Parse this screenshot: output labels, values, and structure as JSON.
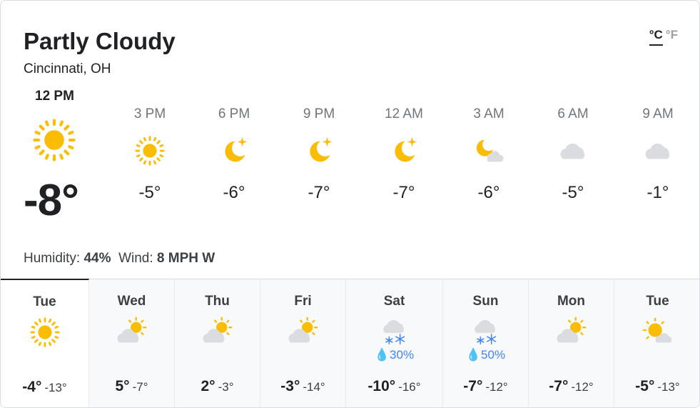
{
  "header": {
    "condition": "Partly Cloudy",
    "location": "Cincinnati, OH",
    "unit_c": "°C",
    "unit_f": "°F"
  },
  "now": {
    "time": "12 PM",
    "temp": "-8°",
    "icon": "sun-icon"
  },
  "hourly": [
    {
      "time": "3 PM",
      "temp": "-5°",
      "icon": "sun-icon"
    },
    {
      "time": "6 PM",
      "temp": "-6°",
      "icon": "moon-star-icon"
    },
    {
      "time": "9 PM",
      "temp": "-7°",
      "icon": "moon-star-icon"
    },
    {
      "time": "12 AM",
      "temp": "-7°",
      "icon": "moon-star-icon"
    },
    {
      "time": "3 AM",
      "temp": "-6°",
      "icon": "moon-cloud-icon"
    },
    {
      "time": "6 AM",
      "temp": "-5°",
      "icon": "cloud-icon"
    },
    {
      "time": "9 AM",
      "temp": "-1°",
      "icon": "cloud-icon"
    }
  ],
  "details": {
    "humidity_label": "Humidity:",
    "humidity_value": "44%",
    "wind_label": "Wind:",
    "wind_value": "8 MPH W"
  },
  "daily": [
    {
      "day": "Tue",
      "hi": "-4°",
      "lo": "-13°",
      "precip": "",
      "icon": "sun-icon"
    },
    {
      "day": "Wed",
      "hi": "5°",
      "lo": "-7°",
      "precip": "",
      "icon": "cloud-sun-icon"
    },
    {
      "day": "Thu",
      "hi": "2°",
      "lo": "-3°",
      "precip": "",
      "icon": "cloud-sun-icon"
    },
    {
      "day": "Fri",
      "hi": "-3°",
      "lo": "-14°",
      "precip": "",
      "icon": "cloud-sun-icon"
    },
    {
      "day": "Sat",
      "hi": "-10°",
      "lo": "-16°",
      "precip": "💧30%",
      "icon": "snow-icon"
    },
    {
      "day": "Sun",
      "hi": "-7°",
      "lo": "-12°",
      "precip": "💧50%",
      "icon": "snow-icon"
    },
    {
      "day": "Mon",
      "hi": "-7°",
      "lo": "-12°",
      "precip": "",
      "icon": "cloud-sun-icon"
    },
    {
      "day": "Tue",
      "hi": "-5°",
      "lo": "-13°",
      "precip": "",
      "icon": "sun-cloud-icon"
    }
  ],
  "colors": {
    "sun": "#fbbc04",
    "cloud": "#dadce0",
    "precip": "#4285f4"
  }
}
